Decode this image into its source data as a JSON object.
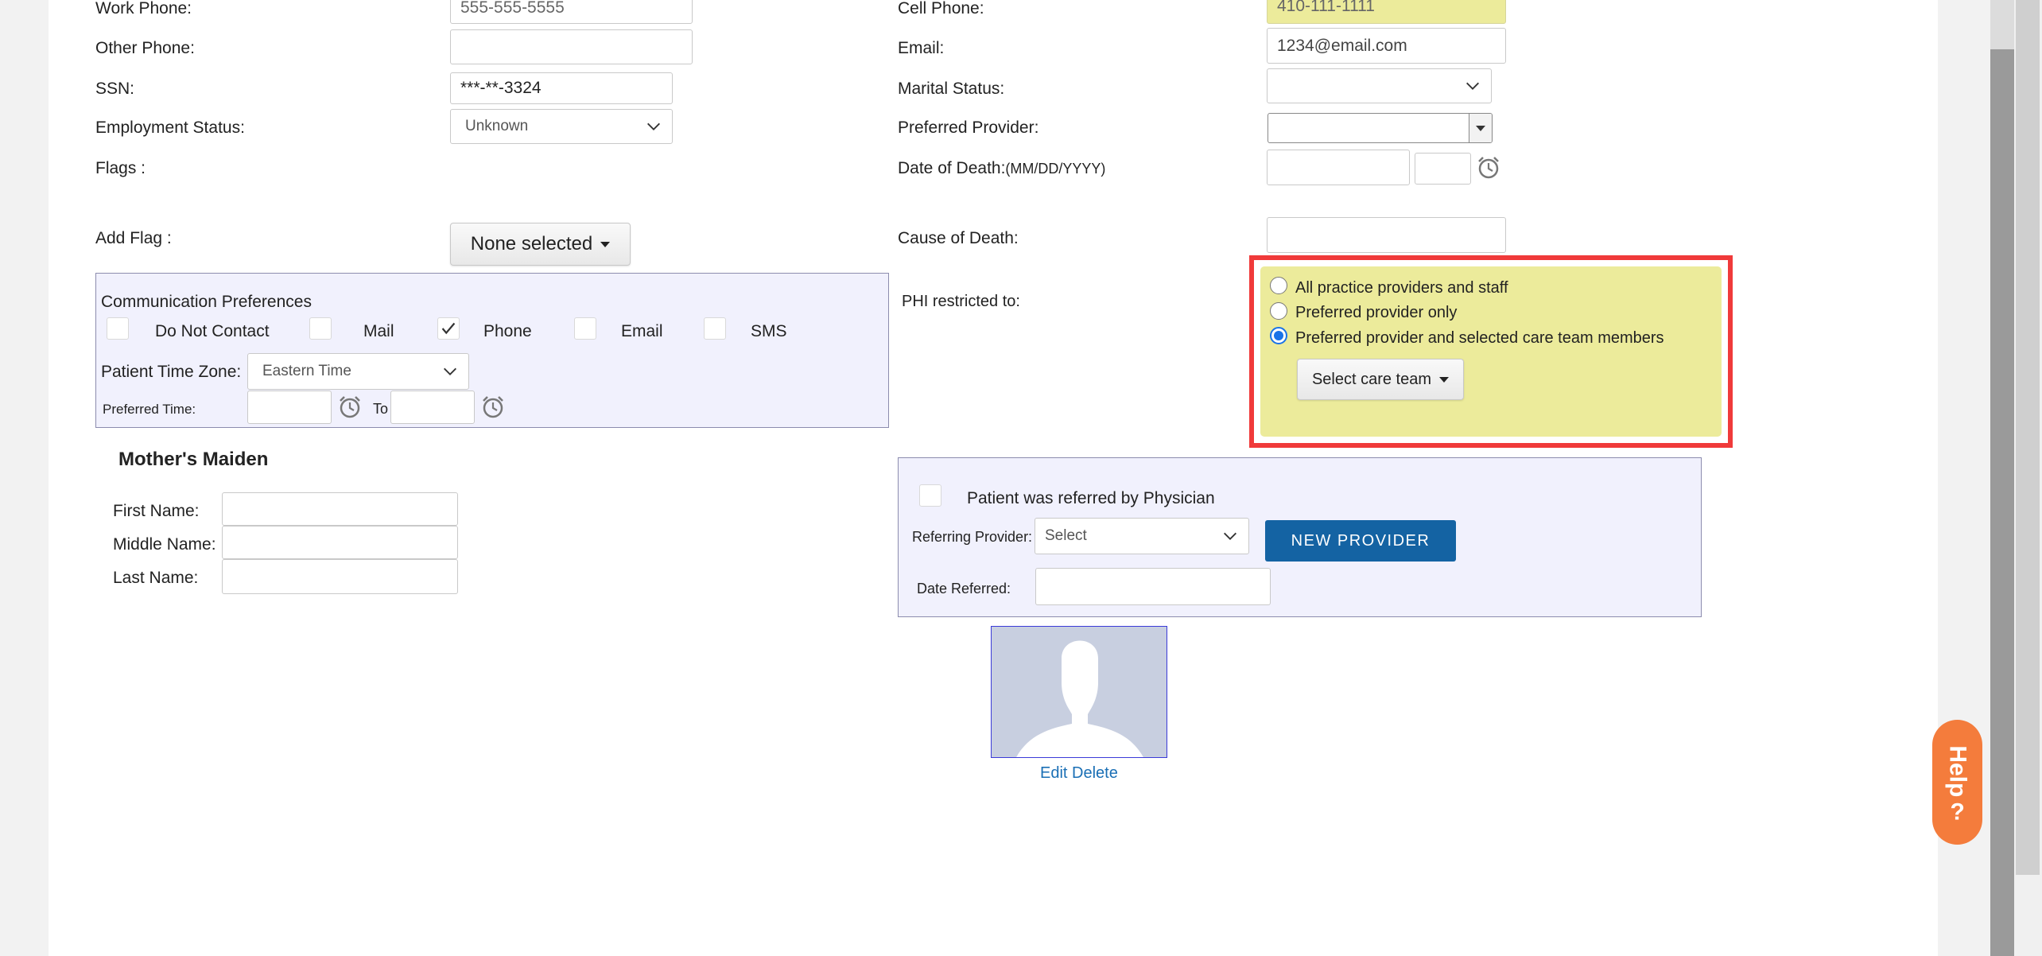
{
  "left": {
    "work_phone": {
      "label": "Work Phone:",
      "value": "555-555-5555"
    },
    "other_phone": {
      "label": "Other Phone:",
      "value": ""
    },
    "ssn": {
      "label": "SSN:",
      "value": "***-**-3324"
    },
    "employment_status": {
      "label": "Employment Status:",
      "value": "Unknown"
    },
    "flags": {
      "label": "Flags :"
    },
    "add_flag": {
      "label": "Add Flag :",
      "button": "None selected"
    }
  },
  "right": {
    "cell_phone": {
      "label": "Cell Phone:",
      "value": "410-111-1111"
    },
    "email": {
      "label": "Email:",
      "value": "1234@email.com"
    },
    "marital_status": {
      "label": "Marital Status:",
      "value": ""
    },
    "preferred_provider": {
      "label": "Preferred Provider:",
      "value": ""
    },
    "date_of_death": {
      "label": "Date of Death:",
      "format": "(MM/DD/YYYY)",
      "date": "",
      "time": ""
    },
    "cause_of_death": {
      "label": "Cause of Death:",
      "value": ""
    }
  },
  "communication": {
    "title": "Communication Preferences",
    "options": [
      {
        "label": "Do Not Contact",
        "checked": false
      },
      {
        "label": "Mail",
        "checked": false
      },
      {
        "label": "Phone",
        "checked": true
      },
      {
        "label": "Email",
        "checked": false
      },
      {
        "label": "SMS",
        "checked": false
      }
    ],
    "time_zone_label": "Patient Time Zone:",
    "time_zone_value": "Eastern Time",
    "preferred_time_label": "Preferred Time:",
    "to_label": "To",
    "from_value": "",
    "to_value": ""
  },
  "phi": {
    "label": "PHI restricted to:",
    "options": [
      {
        "label": "All practice providers and staff",
        "selected": false
      },
      {
        "label": "Preferred provider only",
        "selected": false
      },
      {
        "label": "Preferred provider and selected care team members",
        "selected": true
      }
    ],
    "care_team_button": "Select care team",
    "highlight_color": "#f03a3a"
  },
  "mothers_maiden": {
    "title": "Mother's Maiden",
    "first_name_label": "First Name:",
    "middle_name_label": "Middle Name:",
    "last_name_label": "Last Name:",
    "first_name": "",
    "middle_name": "",
    "last_name": ""
  },
  "referral": {
    "checkbox_label": "Patient was referred by Physician",
    "checked": false,
    "referring_provider_label": "Referring Provider:",
    "referring_provider_value": "Select",
    "new_provider_button": "NEW PROVIDER",
    "date_referred_label": "Date Referred:",
    "date_referred_value": ""
  },
  "photo": {
    "edit_label": "Edit",
    "delete_label": "Delete"
  },
  "help_button": "Help",
  "colors": {
    "accent_blue": "#1463a3",
    "help_orange": "#f47c3c",
    "yellow_field": "#eceb9b",
    "panel_bg": "#f1f1fd"
  }
}
